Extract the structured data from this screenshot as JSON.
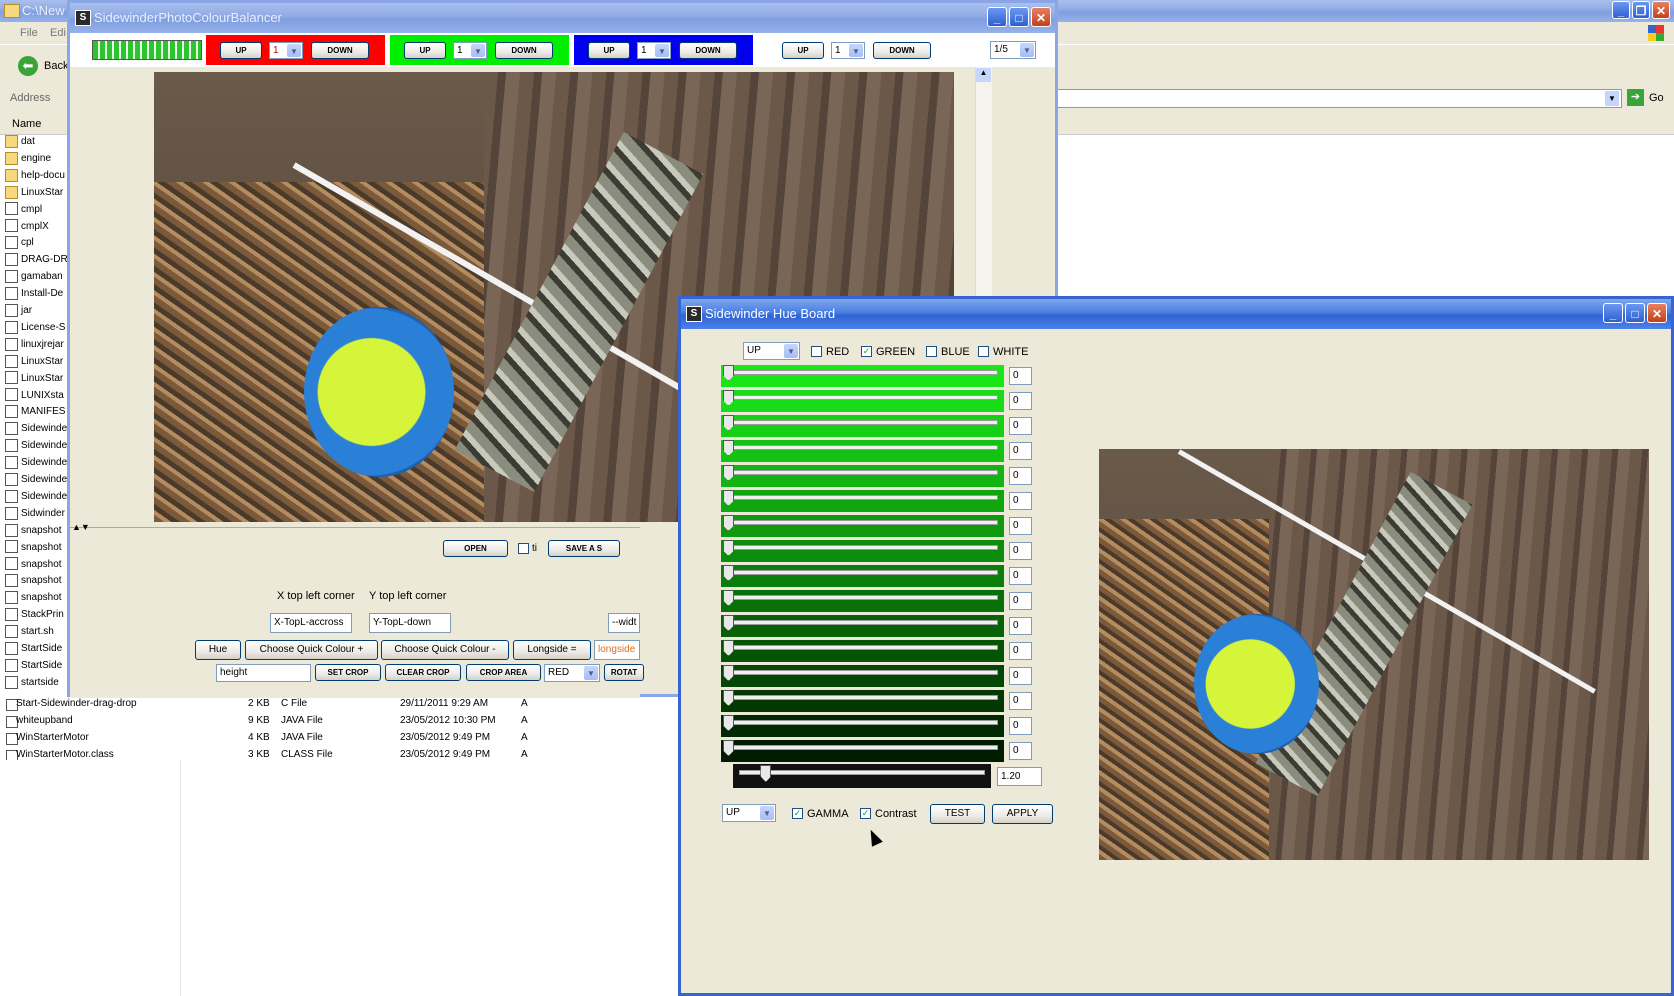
{
  "explorer": {
    "title": "C:\\New",
    "menu": [
      "File",
      "Edi"
    ],
    "back_label": "Back",
    "address_label": "Address",
    "go_label": "Go",
    "col_name": "Name",
    "items": [
      "dat",
      "engine",
      "help-docu",
      "LinuxStar",
      "cmpl",
      "cmplX",
      "cpl",
      "DRAG-DR",
      "gamaban",
      "Install-De",
      "jar",
      "License-S",
      "linuxjrejar",
      "LinuxStar",
      "LinuxStar",
      "LUNIXsta",
      "MANIFES",
      "Sidewinde",
      "Sidewinde",
      "Sidewinde",
      "Sidewinde",
      "Sidewinde",
      "Sidwinder",
      "snapshot",
      "snapshot",
      "snapshot",
      "snapshot",
      "snapshot",
      "StackPrin",
      "start.sh",
      "StartSide",
      "StartSide",
      "startside"
    ],
    "detail_rows": [
      {
        "name": "Start-Sidewinder-drag-drop",
        "size": "2 KB",
        "type": "C File",
        "date": "29/11/2011 9:29 AM",
        "attr": "A"
      },
      {
        "name": "whiteupband",
        "size": "9 KB",
        "type": "JAVA File",
        "date": "23/05/2012 10:30 PM",
        "attr": "A"
      },
      {
        "name": "WinStarterMotor",
        "size": "4 KB",
        "type": "JAVA File",
        "date": "23/05/2012 9:49 PM",
        "attr": "A"
      },
      {
        "name": "WinStarterMotor.class",
        "size": "3 KB",
        "type": "CLASS File",
        "date": "23/05/2012 9:49 PM",
        "attr": "A"
      }
    ]
  },
  "balancer": {
    "title": "SidewinderPhotoColourBalancer",
    "up": "UP",
    "down": "DOWN",
    "red_step": "1",
    "green_step": "1",
    "blue_step": "1",
    "white_step": "1",
    "page": "1/5",
    "open": "OPEN",
    "ti": "ti",
    "save_as": "SAVE A S",
    "x_label": "X top left corner",
    "y_label": "Y top left corner",
    "x_value": "X-TopL-accross",
    "y_value": "Y-TopL-down",
    "width_value": "--widt",
    "hue": "Hue",
    "quick_plus": "Choose Quick Colour +",
    "quick_minus": "Choose Quick Colour -",
    "longside_btn": "Longside =",
    "longside_value": "longside",
    "height_value": "height",
    "set_crop": "SET CROP",
    "clear_crop": "CLEAR CROP",
    "crop_area": "CROP AREA",
    "channel": "RED",
    "rotate": "ROTAT"
  },
  "hueboard": {
    "title": "Sidewinder Hue Board",
    "direction": "UP",
    "red": "RED",
    "green": "GREEN",
    "blue": "BLUE",
    "white": "WHITE",
    "sliders": [
      "0",
      "0",
      "0",
      "0",
      "0",
      "0",
      "0",
      "0",
      "0",
      "0",
      "0",
      "0",
      "0",
      "0",
      "0",
      "0"
    ],
    "slider_colors": [
      "#19e619",
      "#17dc17",
      "#15d015",
      "#13c213",
      "#12b412",
      "#10a610",
      "#0e990e",
      "#0c8c0c",
      "#0a7e0a",
      "#087008",
      "#076207",
      "#055405",
      "#044604",
      "#033803",
      "#022a02",
      "#011c01"
    ],
    "gamma_value": "1.20",
    "gamma_level": 0.09,
    "bottom_direction": "UP",
    "gamma": "GAMMA",
    "contrast": "Contrast",
    "test": "TEST",
    "apply": "APPLY"
  }
}
